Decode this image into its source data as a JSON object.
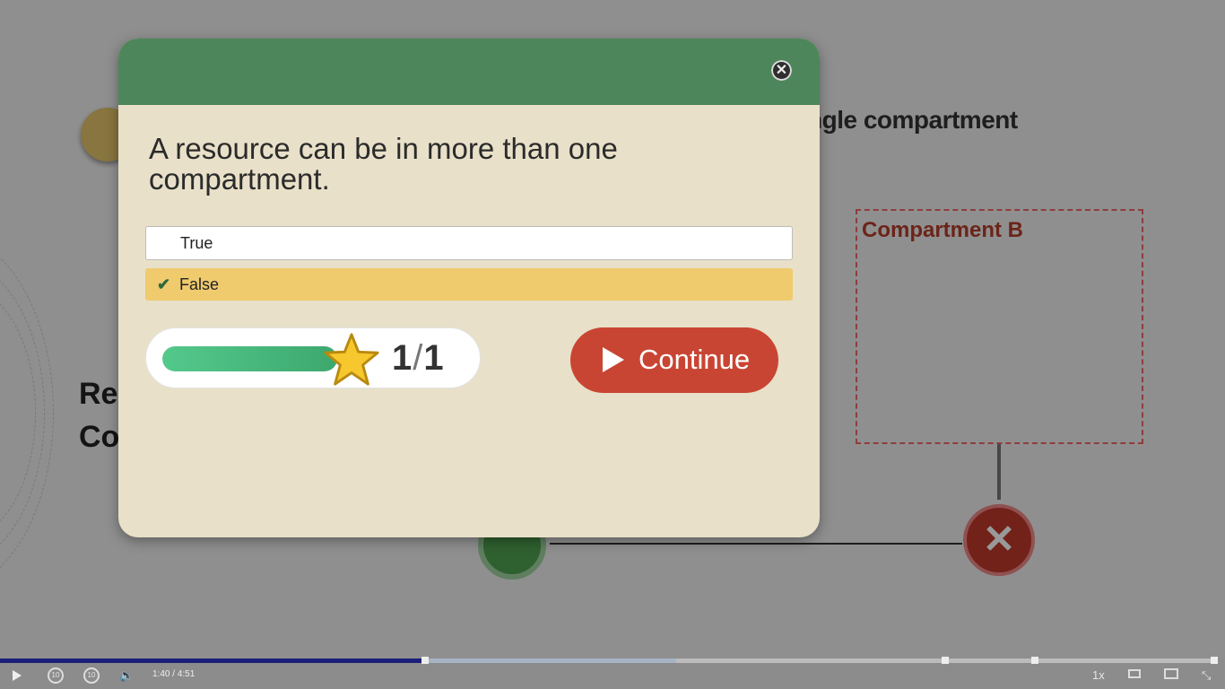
{
  "background": {
    "heading_partial": "ngle compartment",
    "compartment_label": "Compartment B",
    "left_text_line1": "Re",
    "left_text_line2": "Co"
  },
  "modal": {
    "question": "A resource can be in more than one compartment.",
    "options": [
      {
        "label": "True",
        "selected": false
      },
      {
        "label": "False",
        "selected": true
      }
    ],
    "score": {
      "current": "1",
      "separator": "/",
      "total": "1",
      "progress_fraction": 1.0
    },
    "continue_label": "Continue",
    "close_icon": "close-icon",
    "colors": {
      "header": "#4e865b",
      "body": "#e8e0c8",
      "selected_option": "#f0cb6e",
      "continue": "#c94533"
    }
  },
  "player": {
    "current_time": "1:40",
    "time_separator": "/",
    "duration": "4:51",
    "rewind_label": "10",
    "forward_label": "10",
    "speed": "1x",
    "progress_fraction": 0.344,
    "colors": {
      "played": "#1a1f7a"
    }
  }
}
